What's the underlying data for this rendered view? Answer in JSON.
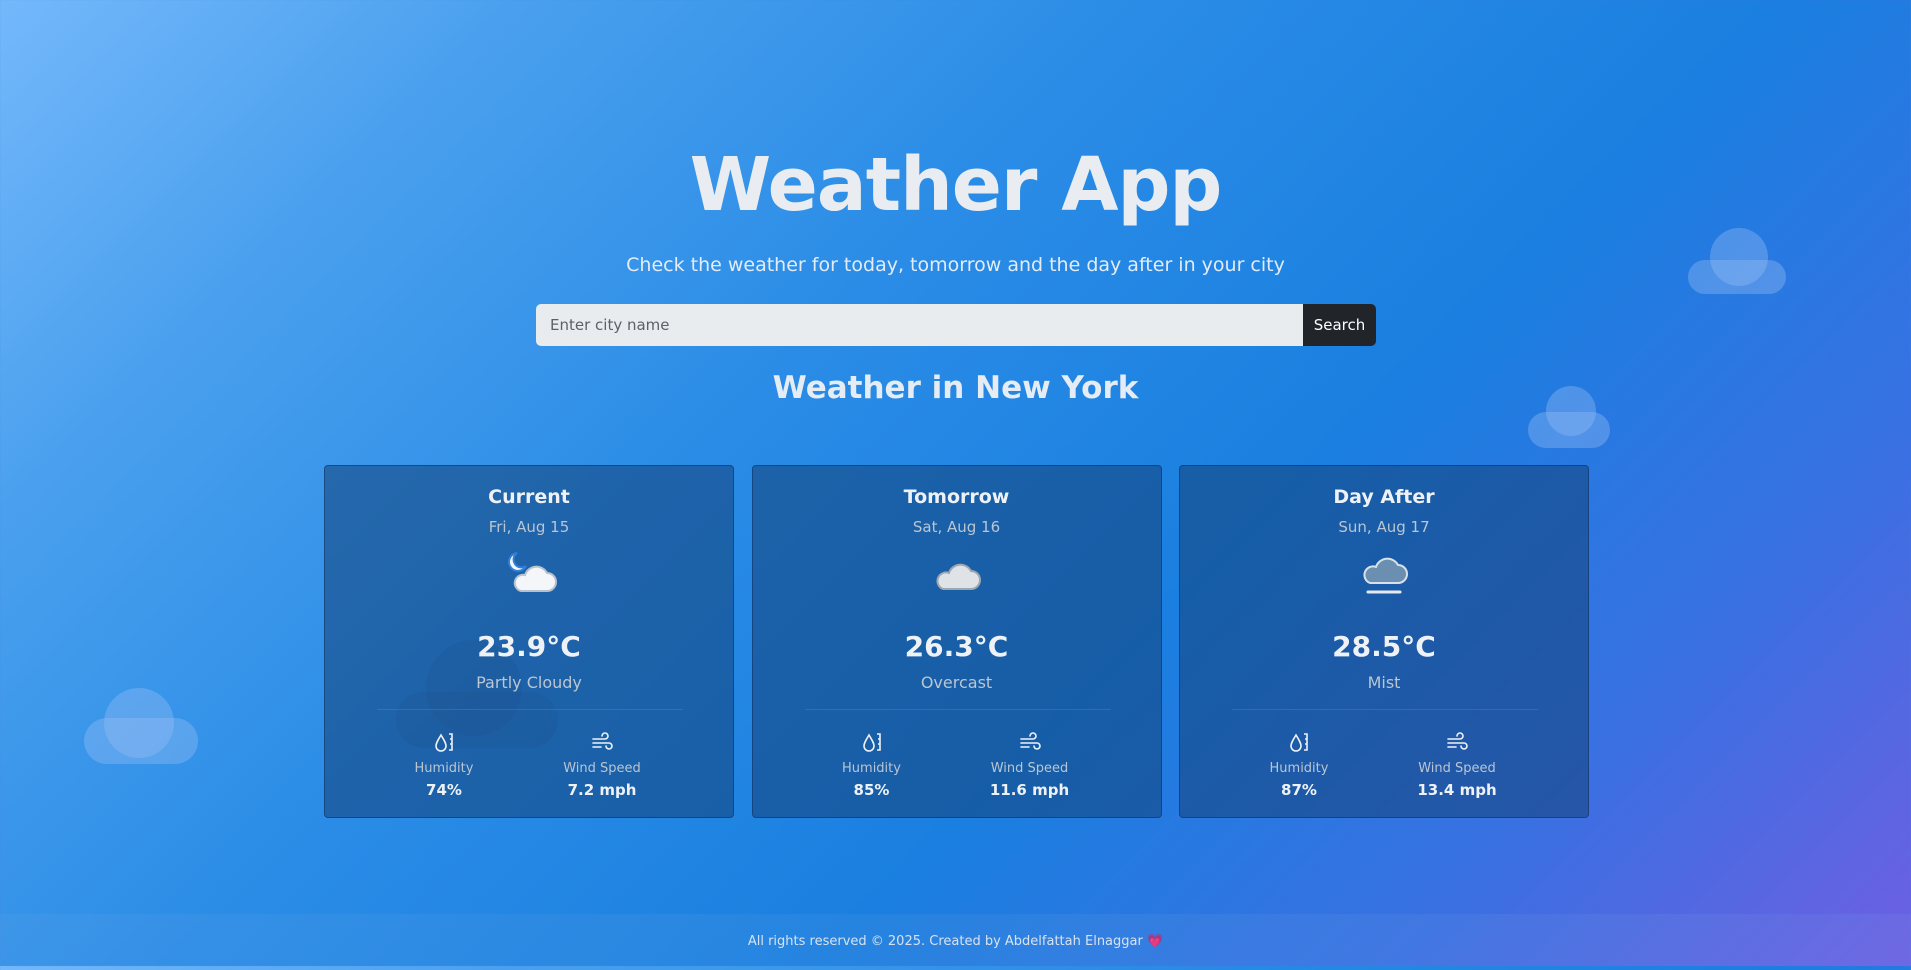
{
  "header": {
    "title": "Weather App",
    "subtitle": "Check the weather for today, tomorrow and the day after in your city"
  },
  "search": {
    "placeholder": "Enter city name",
    "value": "",
    "button_label": "Search"
  },
  "city_heading": "Weather in New York",
  "forecast": [
    {
      "label": "Current",
      "date": "Fri, Aug 15",
      "icon": "partly-cloudy-night-icon",
      "temp": "23.9°C",
      "condition": "Partly Cloudy",
      "humidity_label": "Humidity",
      "humidity": "74%",
      "wind_label": "Wind Speed",
      "wind": "7.2 mph"
    },
    {
      "label": "Tomorrow",
      "date": "Sat, Aug 16",
      "icon": "overcast-cloud-icon",
      "temp": "26.3°C",
      "condition": "Overcast",
      "humidity_label": "Humidity",
      "humidity": "85%",
      "wind_label": "Wind Speed",
      "wind": "11.6 mph"
    },
    {
      "label": "Day After",
      "date": "Sun, Aug 17",
      "icon": "mist-cloud-icon",
      "temp": "28.5°C",
      "condition": "Mist",
      "humidity_label": "Humidity",
      "humidity": "87%",
      "wind_label": "Wind Speed",
      "wind": "13.4 mph"
    }
  ],
  "footer": {
    "text": "All rights reserved © 2025. Created by Abdelfattah Elnaggar",
    "heart": "💗"
  },
  "colors": {
    "search_button_bg": "#212529",
    "card_bg": "#1d4f88",
    "input_bg": "#e9ecef",
    "heart": "#e0407a"
  }
}
